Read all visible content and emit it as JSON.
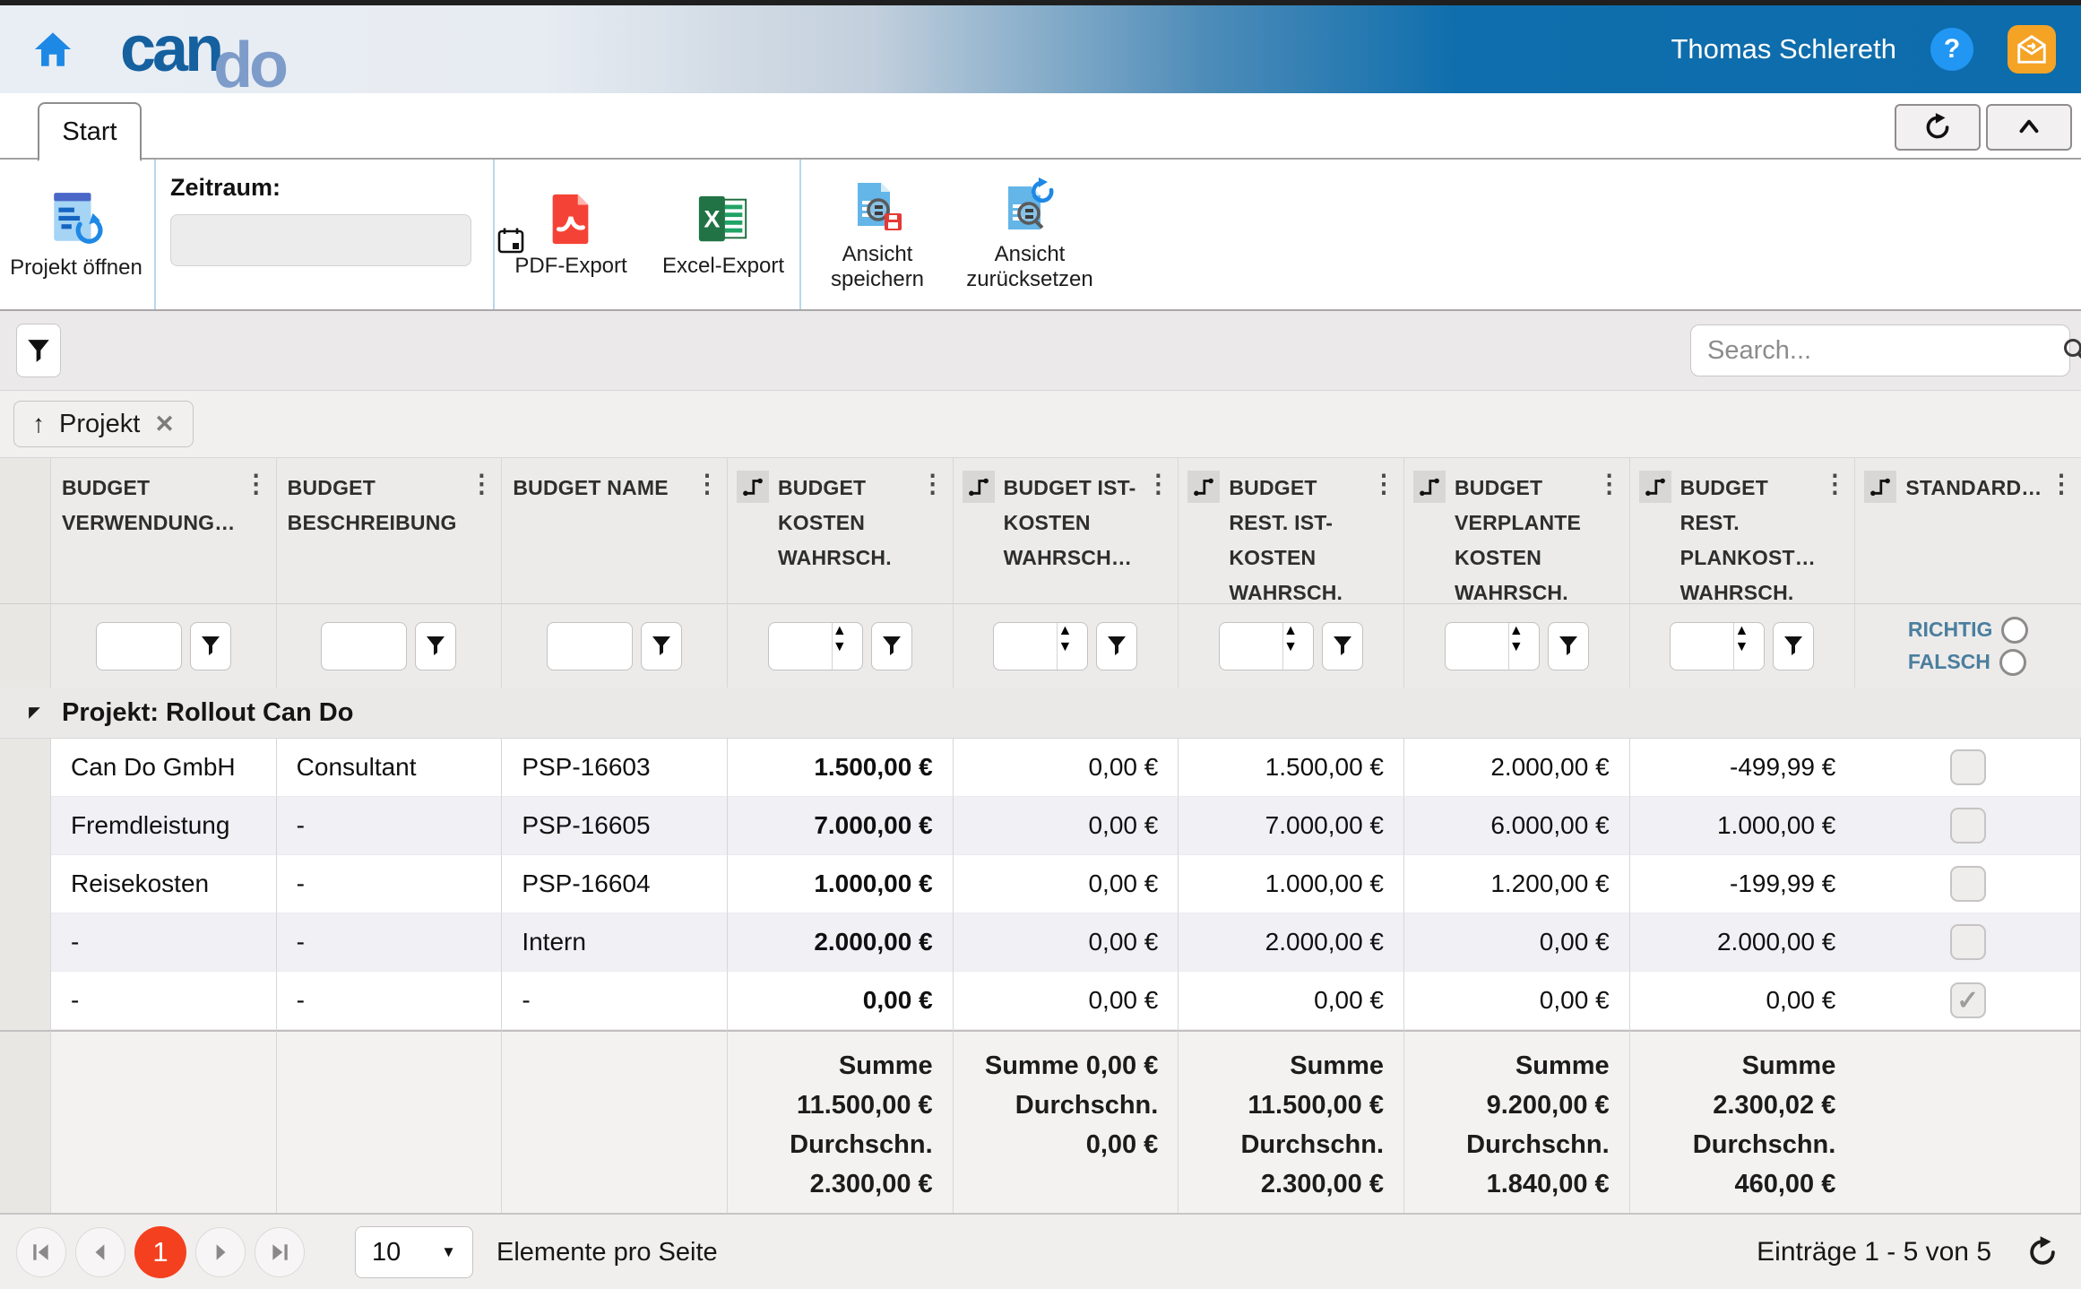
{
  "app": {
    "logo_can": "can",
    "logo_do": "do",
    "user_name": "Thomas Schlereth",
    "help_label": "?"
  },
  "tabs": {
    "start": "Start"
  },
  "toolbar": {
    "project_open_label": "Projekt öffnen",
    "zeitraum_label": "Zeitraum:",
    "zeitraum_value": "",
    "pdf_export_label": "PDF-Export",
    "excel_export_label": "Excel-Export",
    "view_save_label": "Ansicht speichern",
    "view_reset_label": "Ansicht zurücksetzen"
  },
  "filterbar": {
    "search_placeholder": "Search..."
  },
  "grouping": {
    "chip_label": "Projekt"
  },
  "table": {
    "group_header": "Projekt: Rollout Can Do",
    "columns": [
      {
        "label": "BUDGET VERWENDUNG…",
        "sum_icon": false,
        "filter": "text",
        "align": "left",
        "bold": false
      },
      {
        "label": "BUDGET BESCHREIBUNG",
        "sum_icon": false,
        "filter": "text",
        "align": "left",
        "bold": false
      },
      {
        "label": "BUDGET NAME",
        "sum_icon": false,
        "filter": "text",
        "align": "left",
        "bold": false
      },
      {
        "label": "BUDGET KOSTEN WAHRSCH.",
        "sum_icon": true,
        "filter": "number",
        "align": "right",
        "bold": true
      },
      {
        "label": "BUDGET IST-KOSTEN WAHRSCH…",
        "sum_icon": true,
        "filter": "number",
        "align": "right",
        "bold": false
      },
      {
        "label": "BUDGET REST. IST-KOSTEN WAHRSCH.",
        "sum_icon": true,
        "filter": "number",
        "align": "right",
        "bold": false
      },
      {
        "label": "BUDGET VERPLANTE KOSTEN WAHRSCH.",
        "sum_icon": true,
        "filter": "number",
        "align": "right",
        "bold": false
      },
      {
        "label": "BUDGET REST. PLANKOST… WAHRSCH.",
        "sum_icon": true,
        "filter": "number",
        "align": "right",
        "bold": false
      },
      {
        "label": "STANDARD…",
        "sum_icon": true,
        "filter": "boolean",
        "align": "center",
        "bold": false
      }
    ],
    "boolean_filter": {
      "true_label": "RICHTIG",
      "false_label": "FALSCH"
    },
    "rows": [
      {
        "cells": [
          "Can Do GmbH",
          "Consultant",
          "PSP-16603",
          "1.500,00 €",
          "0,00 €",
          "1.500,00 €",
          "2.000,00 €",
          "-499,99 €"
        ],
        "checked": false
      },
      {
        "cells": [
          "Fremdleistung",
          "-",
          "PSP-16605",
          "7.000,00 €",
          "0,00 €",
          "7.000,00 €",
          "6.000,00 €",
          "1.000,00 €"
        ],
        "checked": false
      },
      {
        "cells": [
          "Reisekosten",
          "-",
          "PSP-16604",
          "1.000,00 €",
          "0,00 €",
          "1.000,00 €",
          "1.200,00 €",
          "-199,99 €"
        ],
        "checked": false
      },
      {
        "cells": [
          "-",
          "-",
          "Intern",
          "2.000,00 €",
          "0,00 €",
          "2.000,00 €",
          "0,00 €",
          "2.000,00 €"
        ],
        "checked": false
      },
      {
        "cells": [
          "-",
          "-",
          "-",
          "0,00 €",
          "0,00 €",
          "0,00 €",
          "0,00 €",
          "0,00 €"
        ],
        "checked": true
      }
    ],
    "aggregates": [
      null,
      null,
      null,
      [
        "Summe",
        "11.500,00 €",
        "Durchschn.",
        "2.300,00 €"
      ],
      [
        "Summe 0,00 €",
        "Durchschn.",
        "0,00 €"
      ],
      [
        "Summe",
        "11.500,00 €",
        "Durchschn.",
        "2.300,00 €"
      ],
      [
        "Summe",
        "9.200,00 €",
        "Durchschn.",
        "1.840,00 €"
      ],
      [
        "Summe",
        "2.300,02 €",
        "Durchschn.",
        "460,00 €"
      ],
      null
    ],
    "checkmark": "✓"
  },
  "pager": {
    "current_page": "1",
    "page_size": "10",
    "per_page_label": "Elemente pro Seite",
    "range_label": "Einträge 1 - 5 von 5"
  }
}
